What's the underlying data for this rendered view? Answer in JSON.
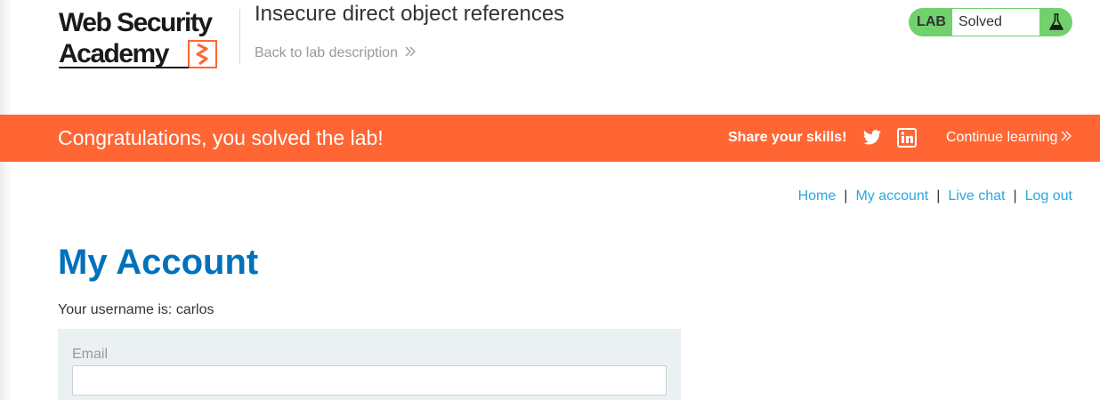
{
  "header": {
    "logo_text": "Web Security Academy",
    "lab_title": "Insecure direct object references",
    "back_link": "Back to lab description",
    "status": {
      "tag": "LAB",
      "text": "Solved",
      "color": "#70d16d"
    }
  },
  "banner": {
    "congrats": "Congratulations, you solved the lab!",
    "share": "Share your skills!",
    "continue": "Continue learning",
    "color": "#ff6633",
    "icons": [
      "twitter-icon",
      "linkedin-icon"
    ]
  },
  "nav": {
    "home": "Home",
    "my_account": "My account",
    "live_chat": "Live chat",
    "log_out": "Log out",
    "separator": "|"
  },
  "main": {
    "title": "My Account",
    "username_text": "Your username is: carlos",
    "form": {
      "email_label": "Email",
      "email_value": ""
    }
  }
}
